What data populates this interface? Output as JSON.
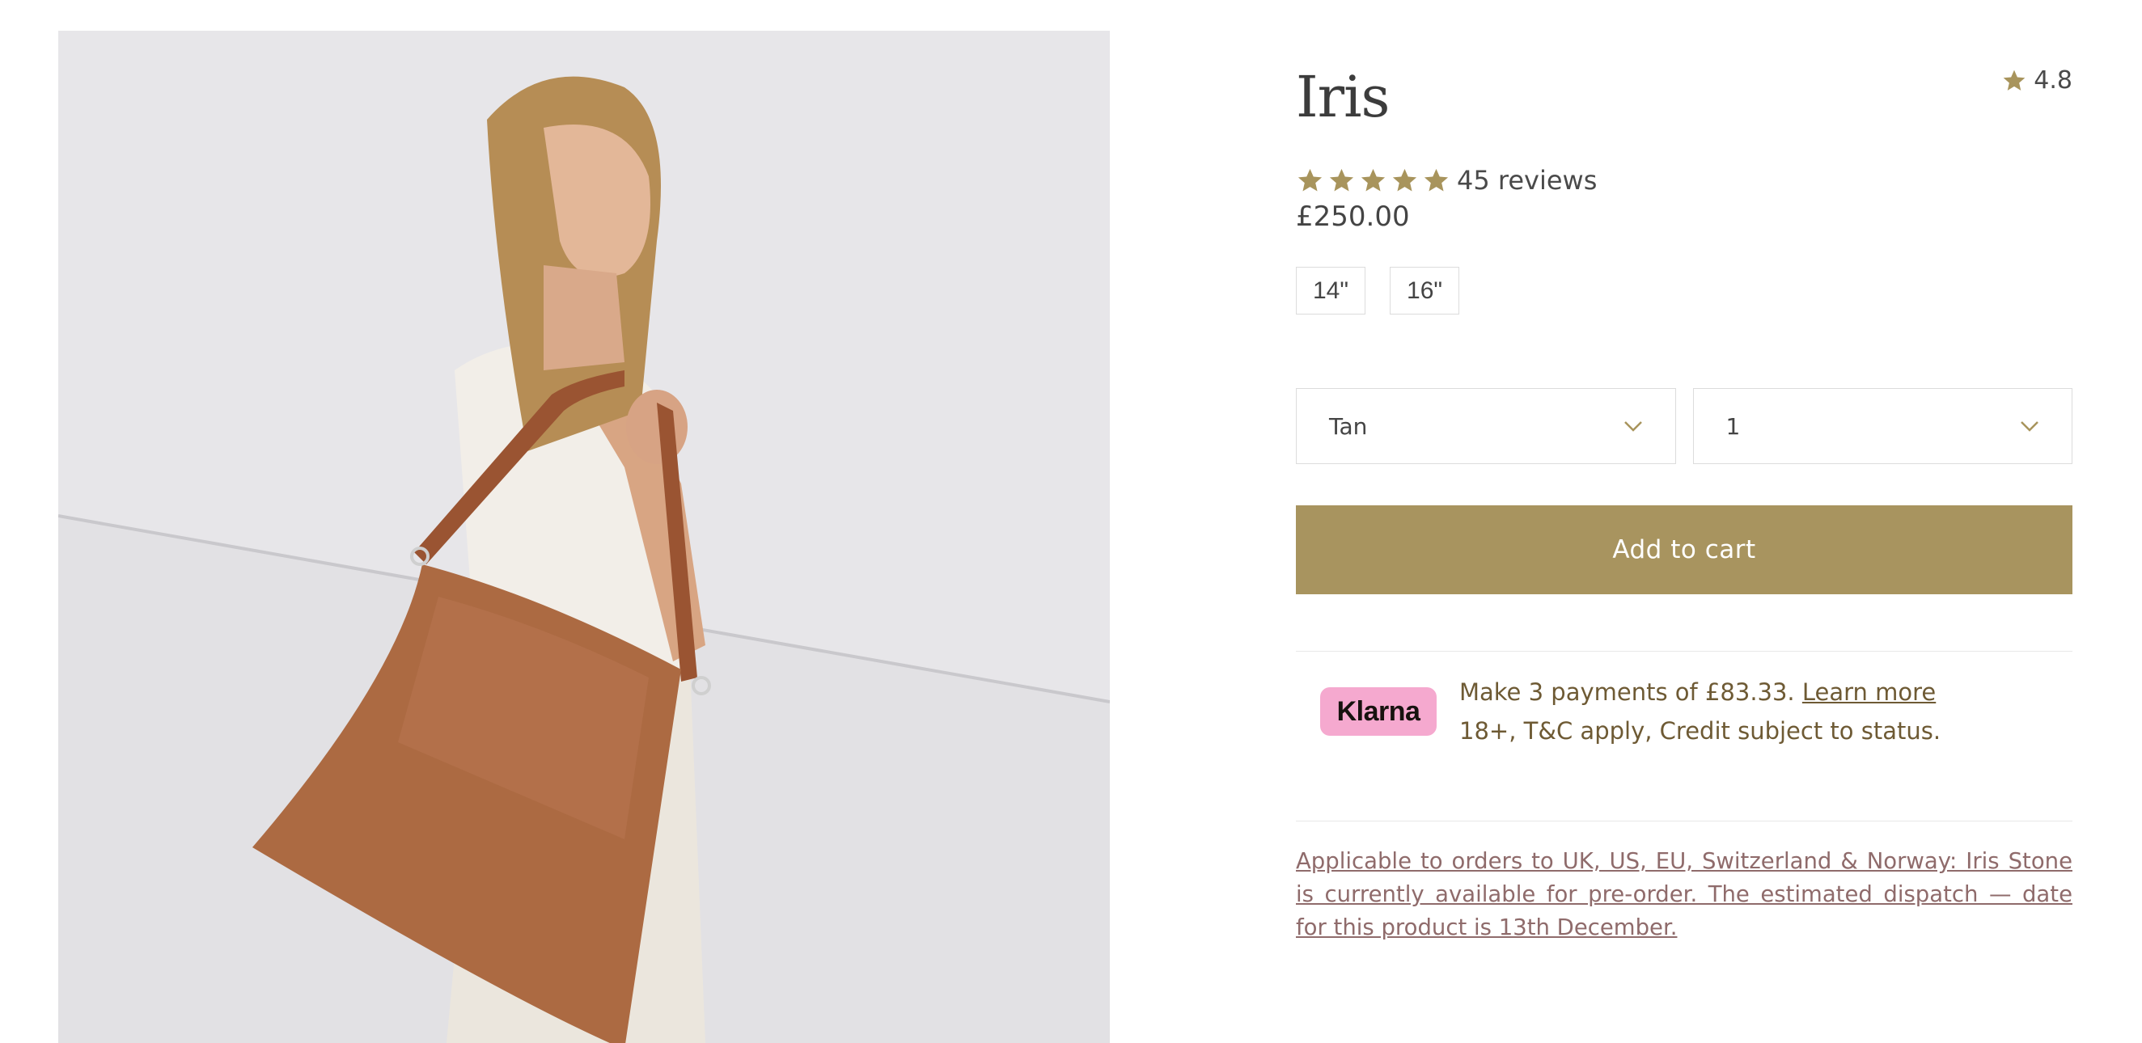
{
  "product": {
    "title": "Iris",
    "rating": "4.8",
    "reviews_label": "45 reviews",
    "review_stars": 5,
    "price": "£250.00",
    "image_alt": "Model carrying tan leather tote bag on shoulder"
  },
  "sizes": [
    {
      "label": "14\""
    },
    {
      "label": "16\""
    }
  ],
  "selects": {
    "color": {
      "value": "Tan"
    },
    "quantity": {
      "value": "1"
    }
  },
  "cart": {
    "add_label": "Add to cart"
  },
  "klarna": {
    "logo": "Klarna",
    "line1": "Make 3 payments of £83.33. ",
    "learn_more": "Learn more",
    "line2": "18+, T&C apply, Credit subject to status."
  },
  "notice": {
    "text": "Applicable to orders to UK, US, EU, Switzerland & Norway: Iris Stone is currently available for pre-order. The estimated dispatch — date for this product is 13th December."
  },
  "icons": {
    "star": "star-icon",
    "chevron": "chevron-down-icon"
  },
  "colors": {
    "accent": "#a8945f",
    "klarna_pink": "#f5a9cf",
    "notice_link": "#8f6b6b"
  }
}
